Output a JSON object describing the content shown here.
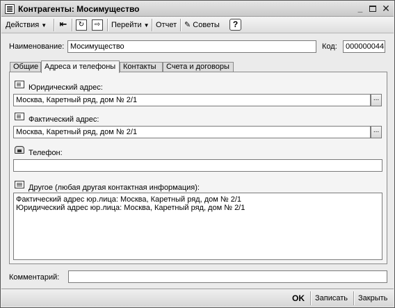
{
  "window": {
    "title": "Контрагенты: Мосимущество"
  },
  "toolbar": {
    "actions_label": "Действия",
    "goto_label": "Перейти",
    "report_label": "Отчет",
    "tips_label": "Советы",
    "help_label": "?"
  },
  "header": {
    "name_label": "Наименование:",
    "name_value": "Мосимущество",
    "code_label": "Код:",
    "code_value": "000000044"
  },
  "tabs": [
    {
      "label": "Общие",
      "active": false
    },
    {
      "label": "Адреса и телефоны",
      "active": true
    },
    {
      "label": "Контакты",
      "active": false
    },
    {
      "label": "Счета и договоры",
      "active": false
    }
  ],
  "addresses": {
    "legal_label": "Юридический адрес:",
    "legal_value": "Москва, Каретный ряд, дом № 2/1",
    "actual_label": "Фактический адрес:",
    "actual_value": "Москва, Каретный ряд, дом № 2/1",
    "phone_label": "Телефон:",
    "phone_value": "",
    "other_label": "Другое (любая другая контактная информация):",
    "other_lines": [
      "Фактический адрес юр.лица: Москва, Каретный ряд, дом № 2/1",
      "Юридический адрес юр.лица: Москва, Каретный ряд, дом № 2/1"
    ],
    "select_button_label": "..."
  },
  "footer": {
    "comment_label": "Комментарий:",
    "comment_value": ""
  },
  "buttons": {
    "ok_label": "OK",
    "save_label": "Записать",
    "close_label": "Закрыть"
  }
}
